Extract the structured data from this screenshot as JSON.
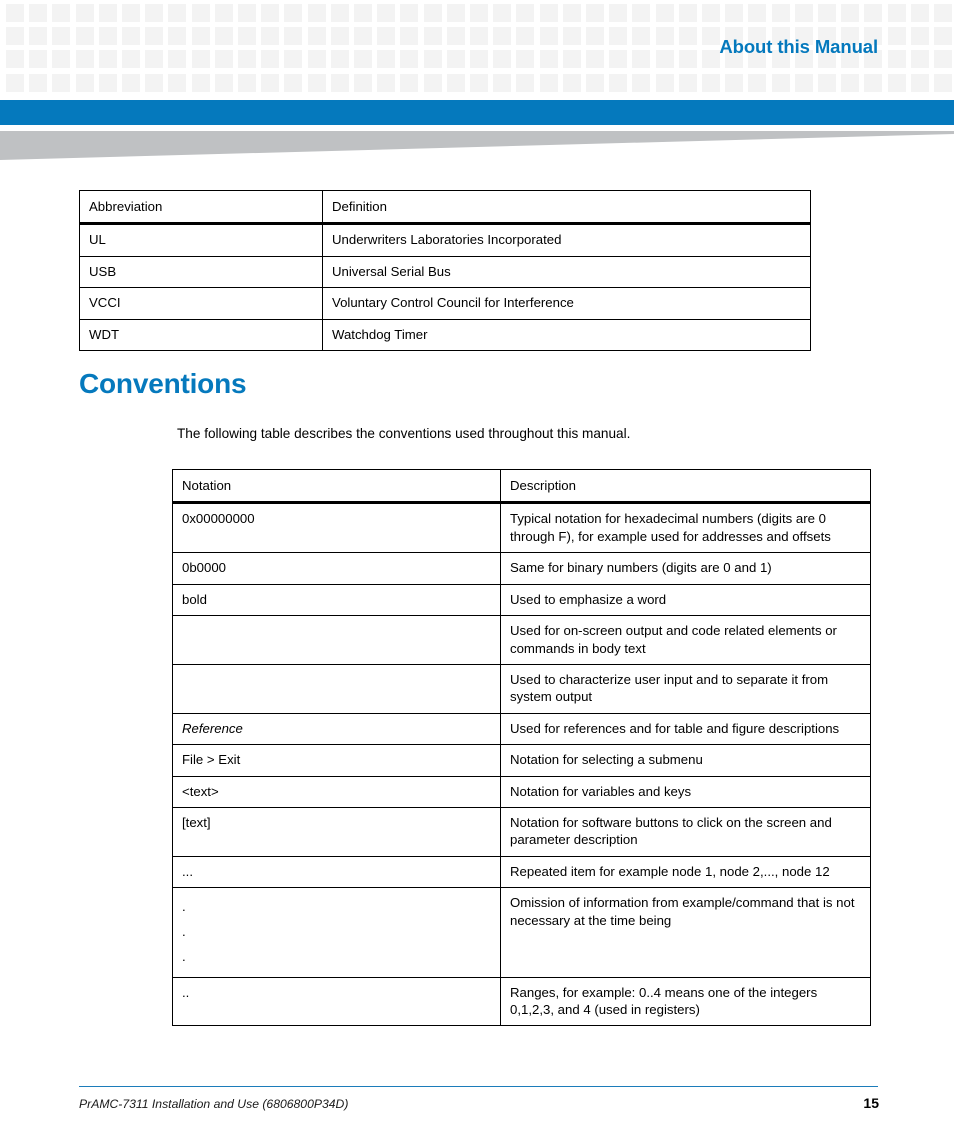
{
  "header": {
    "title": "About this Manual",
    "accent_color": "#0579bd",
    "pattern_color": "#f3f3f3",
    "wedge_color": "#bfc1c3"
  },
  "abbreviation_table": {
    "name": "abbreviation-table",
    "columns": [
      "Abbreviation",
      "Definition"
    ],
    "rows": [
      [
        "UL",
        "Underwriters Laboratories Incorporated"
      ],
      [
        "USB",
        "Universal Serial Bus"
      ],
      [
        "VCCI",
        "Voluntary Control Council for Interference"
      ],
      [
        "WDT",
        "Watchdog Timer"
      ]
    ]
  },
  "section": {
    "heading": "Conventions",
    "intro": "The following table describes the conventions used throughout this manual."
  },
  "conventions_table": {
    "name": "conventions-table",
    "columns": [
      "Notation",
      "Description"
    ],
    "rows": [
      {
        "notation": "0x00000000",
        "style": "normal",
        "description": "Typical notation for hexadecimal numbers (digits are 0 through F), for example used for addresses and offsets"
      },
      {
        "notation": "0b0000",
        "style": "normal",
        "description": "Same for binary numbers (digits are 0 and 1)"
      },
      {
        "notation": "bold",
        "style": "normal",
        "description": "Used to emphasize a word"
      },
      {
        "notation": "",
        "style": "empty",
        "description": "Used for on-screen output and code related elements or commands in body text"
      },
      {
        "notation": "",
        "style": "empty",
        "description": "Used to characterize user input and to separate it from system output"
      },
      {
        "notation": "Reference",
        "style": "italic",
        "description": "Used for references and for table and figure descriptions"
      },
      {
        "notation": "File > Exit",
        "style": "normal",
        "description": "Notation for selecting a submenu"
      },
      {
        "notation": "<text>",
        "style": "normal",
        "description": "Notation for variables and keys"
      },
      {
        "notation": "[text]",
        "style": "normal",
        "description": "Notation for software buttons to click on the screen and parameter description"
      },
      {
        "notation": "...",
        "style": "normal",
        "description": "Repeated item for example node 1, node 2,..., node 12"
      },
      {
        "notation": ".\n.\n.",
        "style": "dots",
        "dots": [
          ".",
          ".",
          "."
        ],
        "description": "Omission of information from example/command that is not necessary at the time being"
      },
      {
        "notation": "..",
        "style": "normal",
        "description": "Ranges, for example: 0..4 means one of the integers 0,1,2,3, and 4 (used in registers)"
      }
    ]
  },
  "footer": {
    "document": "PrAMC-7311 Installation and Use (6806800P34D)",
    "page_number": "15",
    "rule_color": "#1c7cba"
  }
}
